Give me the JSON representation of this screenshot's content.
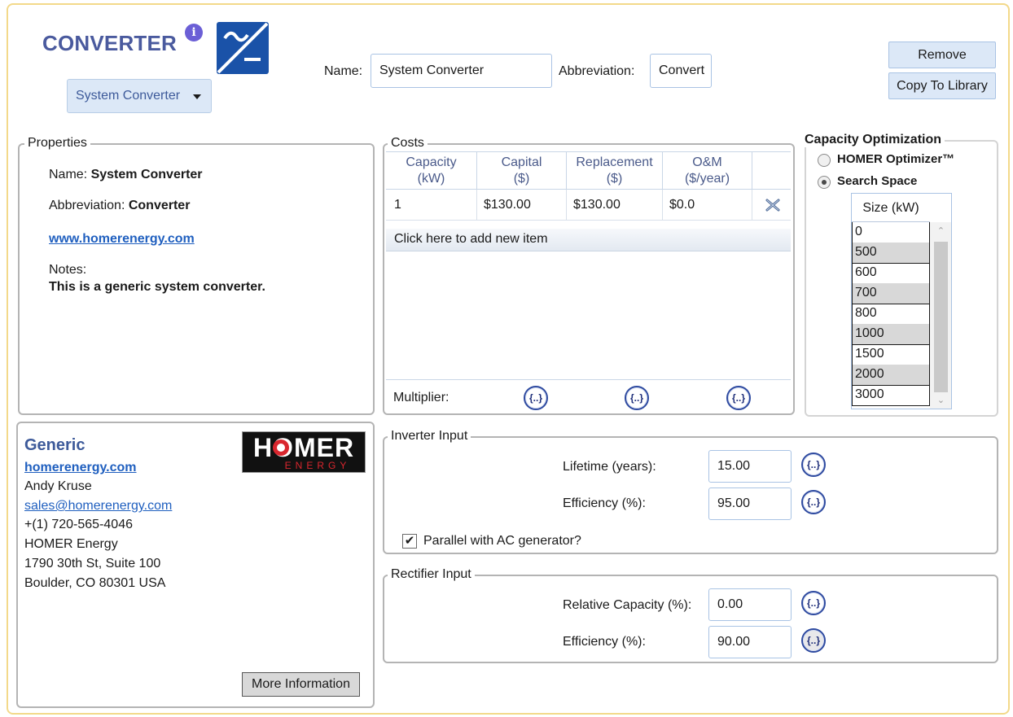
{
  "header": {
    "title": "CONVERTER",
    "info_badge": "i",
    "type_dropdown": "System Converter",
    "name_label": "Name:",
    "name_value": "System Converter",
    "abbr_label": "Abbreviation:",
    "abbr_value": "Convert",
    "remove_label": "Remove",
    "copy_label": "Copy To Library"
  },
  "properties": {
    "title": "Properties",
    "name_label": "Name:",
    "name_value": "System Converter",
    "abbr_label": "Abbreviation:",
    "abbr_value": "Converter",
    "website": "www.homerenergy.com",
    "notes_label": "Notes:",
    "notes_value": "This is a generic system converter."
  },
  "costs": {
    "title": "Costs",
    "columns": [
      {
        "line1": "Capacity",
        "line2": "(kW)"
      },
      {
        "line1": "Capital",
        "line2": "($)"
      },
      {
        "line1": "Replacement",
        "line2": "($)"
      },
      {
        "line1": "O&M",
        "line2": "($/year)"
      }
    ],
    "rows": [
      {
        "capacity": "1",
        "capital": "$130.00",
        "replacement": "$130.00",
        "om": "$0.0"
      }
    ],
    "add_item": "Click here to add new item",
    "multiplier_label": "Multiplier:",
    "curly_label": "{..}"
  },
  "capacity_optimization": {
    "title": "Capacity Optimization",
    "option_optimizer": "HOMER Optimizer™",
    "option_search": "Search Space",
    "selected": "Search Space",
    "size_header": "Size (kW)",
    "sizes": [
      "0",
      "500",
      "600",
      "700",
      "800",
      "1000",
      "1500",
      "2000",
      "3000"
    ]
  },
  "vendor": {
    "name": "Generic",
    "website": "homerenergy.com",
    "contact": "Andy Kruse",
    "email": "sales@homerenergy.com",
    "phone": "+(1) 720-565-4046",
    "company": "HOMER Energy",
    "address1": "1790 30th St, Suite 100",
    "address2": "Boulder, CO 80301 USA",
    "logo_text": "HOMER",
    "logo_sub": "ENERGY",
    "more_info": "More Information"
  },
  "inverter": {
    "title": "Inverter Input",
    "lifetime_label": "Lifetime (years):",
    "lifetime_value": "15.00",
    "efficiency_label": "Efficiency (%):",
    "efficiency_value": "95.00",
    "parallel_label": "Parallel with AC generator?",
    "parallel_checked": true
  },
  "rectifier": {
    "title": "Rectifier Input",
    "rel_capacity_label": "Relative Capacity (%):",
    "rel_capacity_value": "0.00",
    "efficiency_label": "Efficiency (%):",
    "efficiency_value": "90.00"
  },
  "colors": {
    "accent": "#4a5a9e",
    "button_bg": "#dce8f7",
    "link": "#1f5fbf",
    "frame_border": "#f3d98a"
  }
}
